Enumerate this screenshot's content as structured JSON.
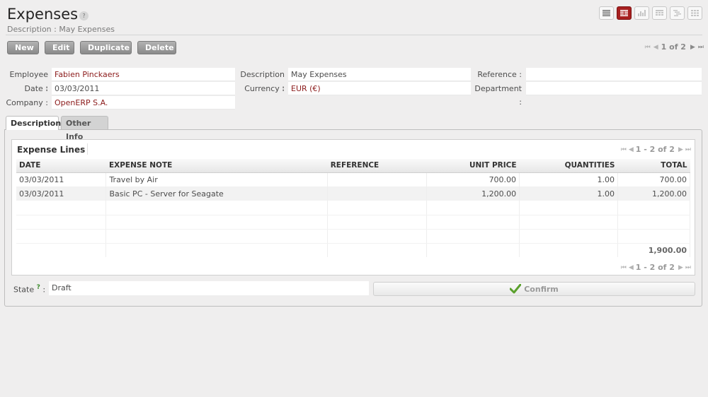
{
  "header": {
    "title": "Expenses",
    "help": "?",
    "subtitle": "Description : May Expenses"
  },
  "views": [
    {
      "name": "list-view-button",
      "icon": "list-icon",
      "active": false
    },
    {
      "name": "form-view-button",
      "icon": "form-icon",
      "active": true
    },
    {
      "name": "graph-view-button",
      "icon": "bar-chart-icon",
      "active": false
    },
    {
      "name": "calendar-view-button",
      "icon": "calendar-icon",
      "active": false
    },
    {
      "name": "gantt-view-button",
      "icon": "gantt-icon",
      "active": false
    },
    {
      "name": "kanban-view-button",
      "icon": "kanban-icon",
      "active": false
    }
  ],
  "actions": {
    "new": "New",
    "edit": "Edit",
    "duplicate": "Duplicate",
    "delete": "Delete"
  },
  "pager": {
    "first": "⏮",
    "prev": "◀",
    "count": "1 of 2",
    "next": "▶",
    "last": "⏭"
  },
  "form": {
    "employee_label": "Employee :",
    "employee": "Fabien Pinckaers",
    "date_label": "Date :",
    "date": "03/03/2011",
    "company_label": "Company :",
    "company": "OpenERP S.A.",
    "description_label": "Description :",
    "description": "May Expenses",
    "currency_label": "Currency :",
    "currency": "EUR (€)",
    "reference_label": "Reference :",
    "reference": "",
    "department_label": "Department :",
    "department": ""
  },
  "tabs": {
    "description": "Description",
    "other_info": "Other Info"
  },
  "expense_lines": {
    "title": "Expense Lines",
    "pager": "1 - 2 of 2",
    "columns": {
      "date": "DATE",
      "note": "EXPENSE NOTE",
      "reference": "REFERENCE",
      "unit_price": "UNIT PRICE",
      "quantities": "QUANTITIES",
      "total": "TOTAL"
    },
    "rows": [
      {
        "date": "03/03/2011",
        "note": "Travel by Air",
        "reference": "",
        "unit_price": "700.00",
        "quantities": "1.00",
        "total": "700.00"
      },
      {
        "date": "03/03/2011",
        "note": "Basic PC - Server for Seagate",
        "reference": "",
        "unit_price": "1,200.00",
        "quantities": "1.00",
        "total": "1,200.00"
      }
    ],
    "sum_total": "1,900.00"
  },
  "state": {
    "label": "State",
    "help": "?",
    "separator": ":",
    "value": "Draft"
  },
  "confirm": {
    "label": "Confirm",
    "icon": "checkmark-icon",
    "icon_color": "#5aa02c"
  },
  "colors": {
    "accent": "#a72020",
    "link": "#8b1a1a"
  }
}
